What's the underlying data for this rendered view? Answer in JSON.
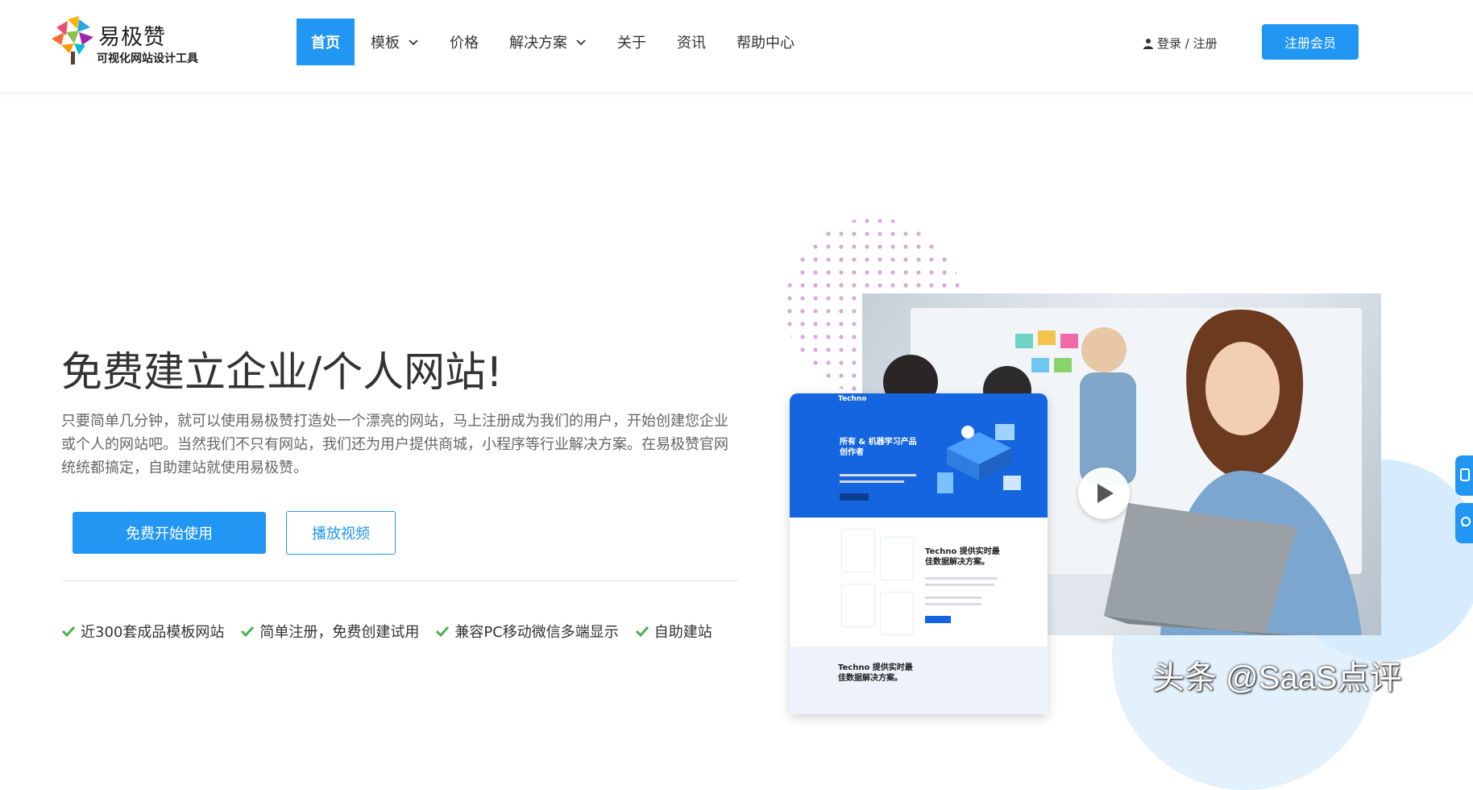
{
  "brand": {
    "name": "易极赞",
    "tagline": "可视化网站设计工具"
  },
  "nav": {
    "items": [
      {
        "label": "首页",
        "active": true,
        "dropdown": false
      },
      {
        "label": "模板",
        "active": false,
        "dropdown": true
      },
      {
        "label": "价格",
        "active": false,
        "dropdown": false
      },
      {
        "label": "解决方案",
        "active": false,
        "dropdown": true
      },
      {
        "label": "关于",
        "active": false,
        "dropdown": false
      },
      {
        "label": "资讯",
        "active": false,
        "dropdown": false
      },
      {
        "label": "帮助中心",
        "active": false,
        "dropdown": false
      }
    ]
  },
  "account": {
    "login_label": "登录 / 注册",
    "register_label": "注册会员"
  },
  "hero": {
    "title": "免费建立企业/个人网站!",
    "description": "只要简单几分钟，就可以使用易极赞打造处一个漂亮的网站，马上注册成为我们的用户，开始创建您企业或个人的网站吧。当然我们不只有网站，我们还为用户提供商城，小程序等行业解决方案。在易极赞官网统统都搞定，自助建站就使用易极赞。",
    "primary_button": "免费开始使用",
    "secondary_button": "播放视频",
    "features": [
      "近300套成品模板网站",
      "简单注册，免费创建试用",
      "兼容PC移动微信多端显示",
      "自助建站"
    ]
  },
  "mockup": {
    "logo": "Techno",
    "headline": "所有 & 机器学习产品创作者",
    "section_title": "Techno 提供实时最佳数据解决方案。",
    "section_title_2": "Techno 提供实时最佳数据解决方案。"
  },
  "watermark": "头条 @SaaS点评",
  "colors": {
    "accent": "#2196f3",
    "check": "#4caf50"
  },
  "icons": {
    "user": "user-icon",
    "check": "check-icon",
    "chevron": "chevron-down-icon",
    "play": "play-icon"
  }
}
